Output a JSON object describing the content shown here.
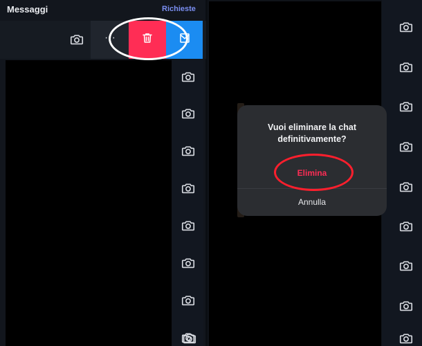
{
  "header": {
    "title": "Messaggi",
    "requests_link": "Richieste"
  },
  "swipe_actions": {
    "more_label": "···",
    "delete_icon": "trash-icon",
    "mark_icon": "mail-icon",
    "colors": {
      "delete": "#ff2d55",
      "mark": "#1b8cf2",
      "more": "#20252d"
    }
  },
  "dialog": {
    "title": "Vuoi eliminare la chat definitivamente?",
    "confirm_label": "Elimina",
    "cancel_label": "Annulla"
  },
  "icons": {
    "camera": "camera-icon"
  }
}
